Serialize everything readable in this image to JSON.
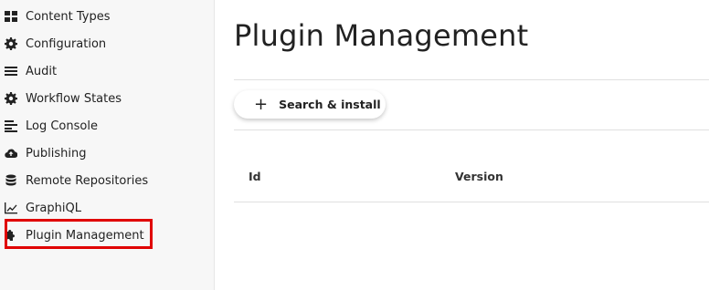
{
  "sidebar": {
    "items": [
      {
        "label": "Content Types",
        "icon": "grid-icon"
      },
      {
        "label": "Configuration",
        "icon": "gear-icon"
      },
      {
        "label": "Audit",
        "icon": "list-icon"
      },
      {
        "label": "Workflow States",
        "icon": "gear-icon"
      },
      {
        "label": "Log Console",
        "icon": "align-left-icon"
      },
      {
        "label": "Publishing",
        "icon": "cloud-upload-icon"
      },
      {
        "label": "Remote Repositories",
        "icon": "database-icon"
      },
      {
        "label": "GraphiQL",
        "icon": "chart-line-icon"
      },
      {
        "label": "Plugin Management",
        "icon": "puzzle-icon"
      }
    ]
  },
  "main": {
    "title": "Plugin Management",
    "search_install_label": "Search & install",
    "table": {
      "columns": [
        "Id",
        "Version"
      ]
    }
  },
  "colors": {
    "highlight": "#e00000",
    "sidebar_bg": "#f7f7f7"
  }
}
